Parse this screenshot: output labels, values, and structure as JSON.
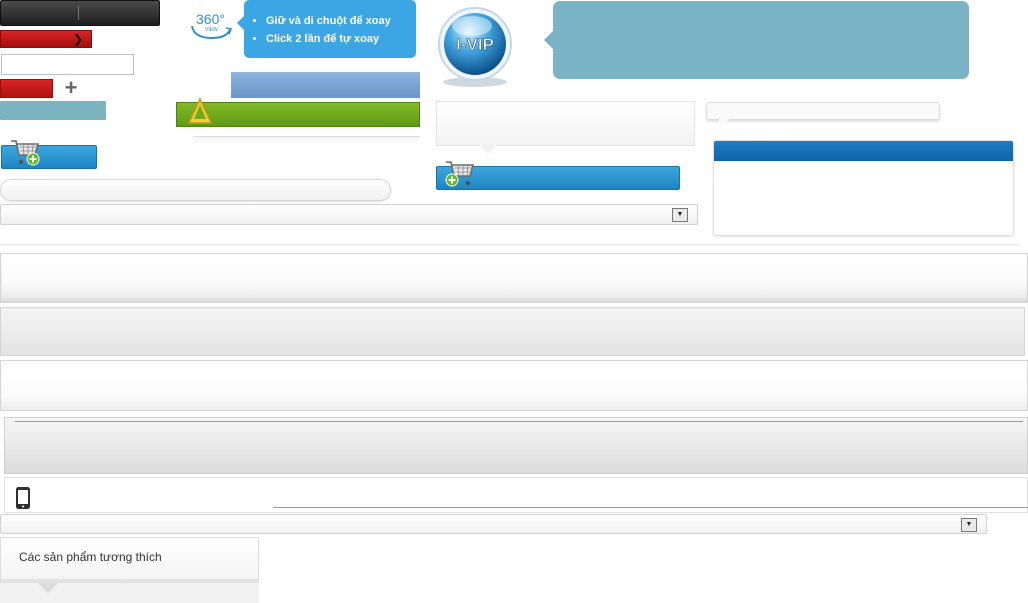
{
  "hint_360": {
    "badge_text": "360°",
    "badge_subtext": "VIEW",
    "lines": [
      "Giữ và di chuột để xoay",
      "Click 2 lần để tự xoay"
    ]
  },
  "vip_badge": {
    "text": "I-VIP"
  },
  "compatible_products": {
    "title": "Các sản phẩm tương thích"
  },
  "colors": {
    "accent_blue": "#3ba6e3",
    "panel_teal": "#7ab3c5",
    "header_blue": "#1f7ec6",
    "green": "#6fab1d",
    "red": "#c41a1a"
  },
  "icons": [
    "chevron-right-icon",
    "plus-icon",
    "cart-add-icon",
    "view-360-icon",
    "warning-triangle-icon",
    "dropdown-arrow-icon",
    "mobile-phone-icon"
  ]
}
